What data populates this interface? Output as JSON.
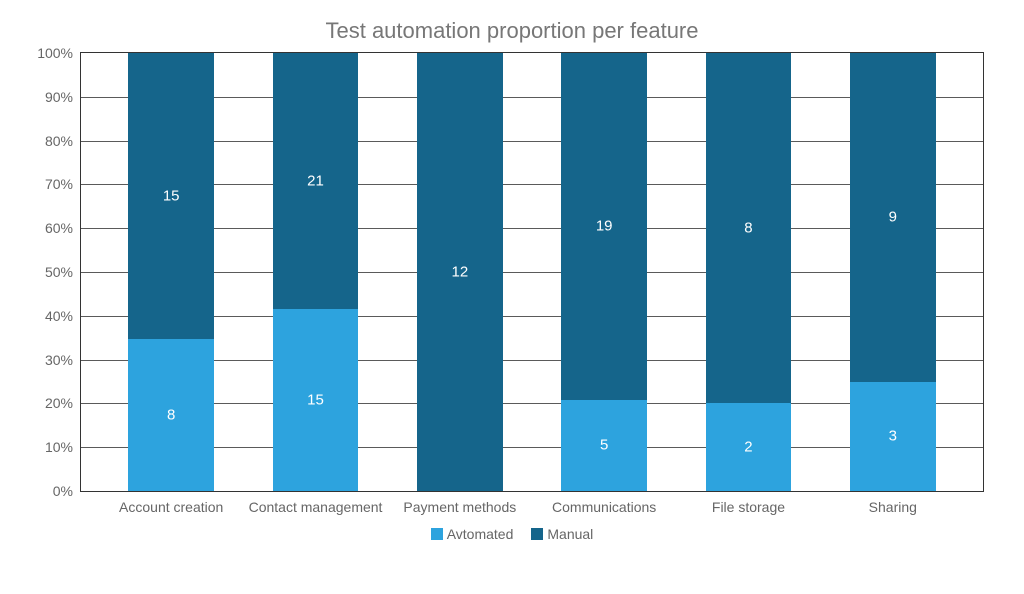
{
  "chart_data": {
    "type": "bar",
    "stacked_percent": true,
    "title": "Test automation proportion per feature",
    "categories": [
      "Account creation",
      "Contact management",
      "Payment methods",
      "Communications",
      "File storage",
      "Sharing"
    ],
    "series": [
      {
        "name": "Avtomated",
        "color": "#2da3de",
        "values": [
          8,
          15,
          0,
          5,
          2,
          3
        ]
      },
      {
        "name": "Manual",
        "color": "#15658b",
        "values": [
          15,
          21,
          12,
          19,
          8,
          9
        ]
      }
    ],
    "ylabel": "",
    "ylim": [
      0,
      100
    ],
    "yticks": [
      "0%",
      "10%",
      "20%",
      "30%",
      "40%",
      "50%",
      "60%",
      "70%",
      "80%",
      "90%",
      "100%"
    ]
  },
  "bar_layout": {
    "bar_width_pct": 9.5,
    "positions_pct": [
      10,
      26,
      42,
      58,
      74,
      90
    ]
  }
}
